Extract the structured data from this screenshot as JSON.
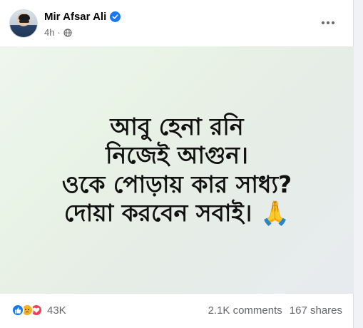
{
  "post": {
    "author": "Mir Afsar Ali",
    "timestamp": "4h",
    "separator": "·",
    "verified_icon": "verified-badge-icon",
    "privacy_icon": "globe-icon",
    "more_icon": "more-options-icon",
    "body_text": "আবু হেনা রনি\nনিজেই আগুন।\nওকে পোড়ায় কার সাধ্য?\nদোয়া করবেন সবাই। 🙏"
  },
  "footer": {
    "reaction_icons": [
      "like-icon",
      "sad-icon",
      "love-icon"
    ],
    "reaction_count": "43K",
    "comments": "2.1K comments",
    "shares": "167 shares"
  },
  "colors": {
    "accent": "#1877f2",
    "love": "#f33e58",
    "sad": "#f7b125",
    "secondary_text": "#65676b"
  }
}
